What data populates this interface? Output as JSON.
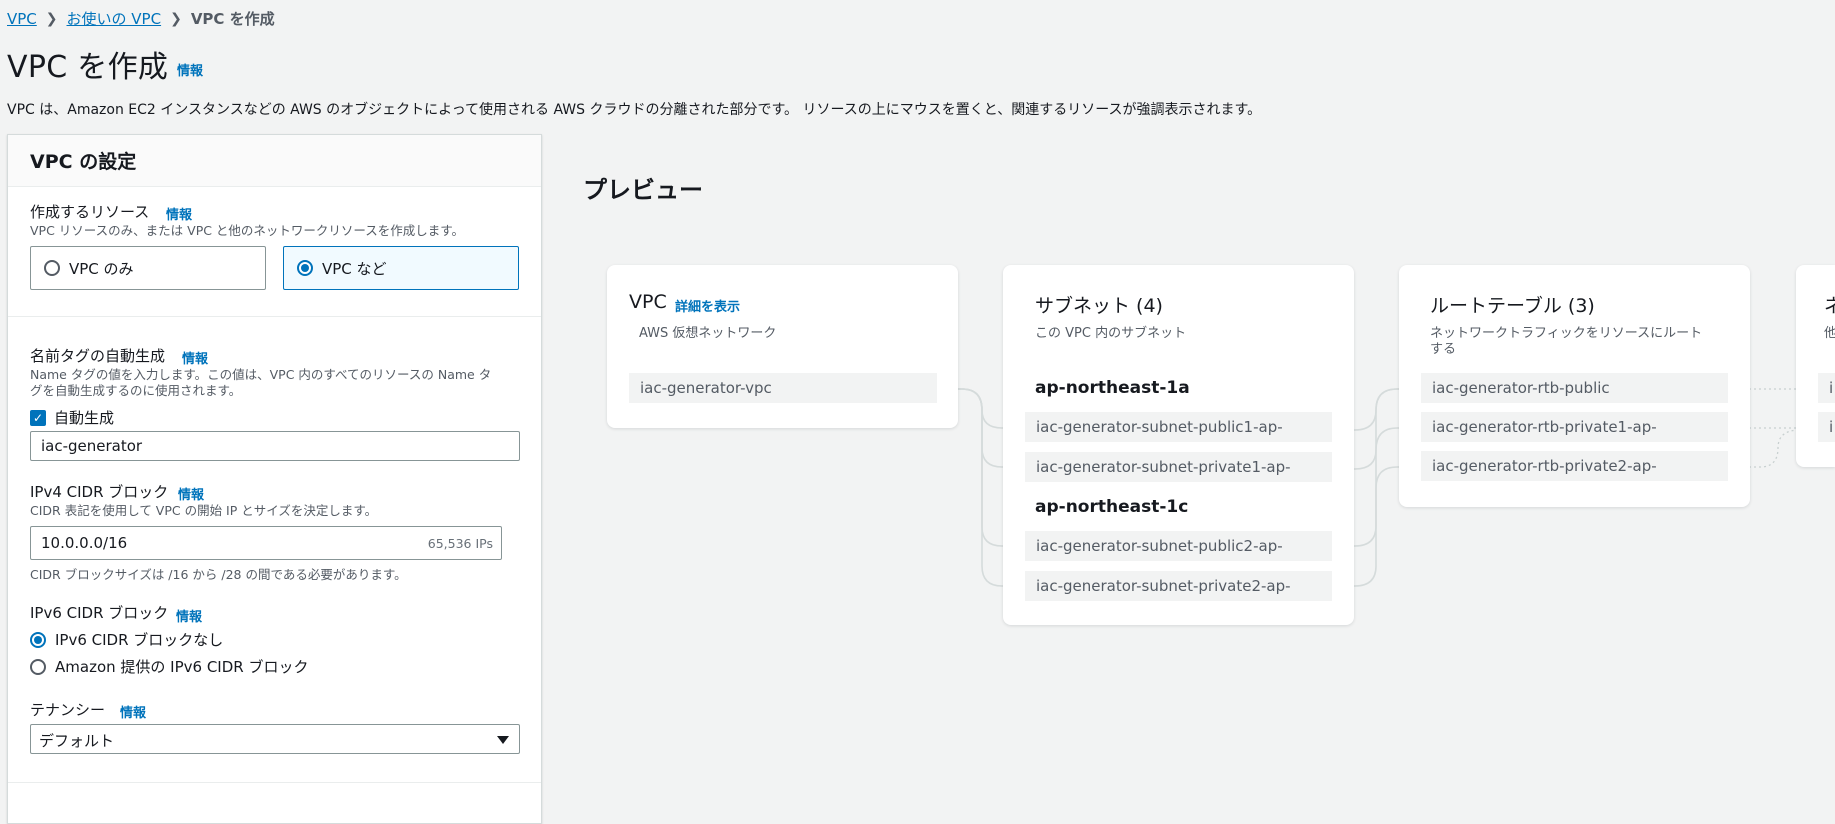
{
  "breadcrumb": {
    "items": [
      "VPC",
      "お使いの VPC"
    ],
    "current": "VPC を作成"
  },
  "page": {
    "title": "VPC を作成",
    "info": "情報",
    "description": "VPC は、Amazon EC2 インスタンスなどの AWS のオブジェクトによって使用される AWS クラウドの分離された部分です。 リソースの上にマウスを置くと、関連するリソースが強調表示されます。"
  },
  "settings": {
    "header": "VPC の設定",
    "resources": {
      "label": "作成するリソース",
      "info": "情報",
      "hint": "VPC リソースのみ、または VPC と他のネットワークリソースを作成します。",
      "options": [
        "VPC のみ",
        "VPC など"
      ],
      "selected": "VPC など"
    },
    "name_tag": {
      "label": "名前タグの自動生成",
      "info": "情報",
      "hint_line1": "Name タグの値を入力します。この値は、VPC 内のすべてのリソースの Name タ",
      "hint_line2": "グを自動生成するのに使用されます。",
      "checkbox_label": "自動生成",
      "checked": true,
      "value": "iac-generator"
    },
    "ipv4": {
      "label": "IPv4 CIDR ブロック",
      "info": "情報",
      "hint": "CIDR 表記を使用して VPC の開始 IP とサイズを決定します。",
      "value": "10.0.0.0/16",
      "suffix": "65,536 IPs",
      "constraint": "CIDR ブロックサイズは /16 から /28 の間である必要があります。"
    },
    "ipv6": {
      "label": "IPv6 CIDR ブロック",
      "info": "情報",
      "options": [
        "IPv6 CIDR ブロックなし",
        "Amazon 提供の IPv6 CIDR ブロック"
      ],
      "selected": "IPv6 CIDR ブロックなし"
    },
    "tenancy": {
      "label": "テナンシー",
      "info": "情報",
      "value": "デフォルト"
    }
  },
  "preview": {
    "title": "プレビュー",
    "vpc": {
      "title": "VPC",
      "link": "詳細を表示",
      "subtitle": "AWS 仮想ネットワーク",
      "items": [
        "iac-generator-vpc"
      ]
    },
    "subnets": {
      "title": "サブネット (4)",
      "subtitle": "この VPC 内のサブネット",
      "zones": [
        {
          "name": "ap-northeast-1a",
          "items": [
            "iac-generator-subnet-public1-ap-",
            "iac-generator-subnet-private1-ap-"
          ]
        },
        {
          "name": "ap-northeast-1c",
          "items": [
            "iac-generator-subnet-public2-ap-",
            "iac-generator-subnet-private2-ap-"
          ]
        }
      ]
    },
    "route_tables": {
      "title": "ルートテーブル (3)",
      "subtitle_line1": "ネットワークトラフィックをリソースにルート",
      "subtitle_line2": "する",
      "items": [
        "iac-generator-rtb-public",
        "iac-generator-rtb-private1-ap-",
        "iac-generator-rtb-private2-ap-"
      ]
    },
    "network_connections": {
      "title_partial": "ネ",
      "subtitle_partial": "他",
      "items_partial": [
        "i",
        "i"
      ]
    }
  }
}
